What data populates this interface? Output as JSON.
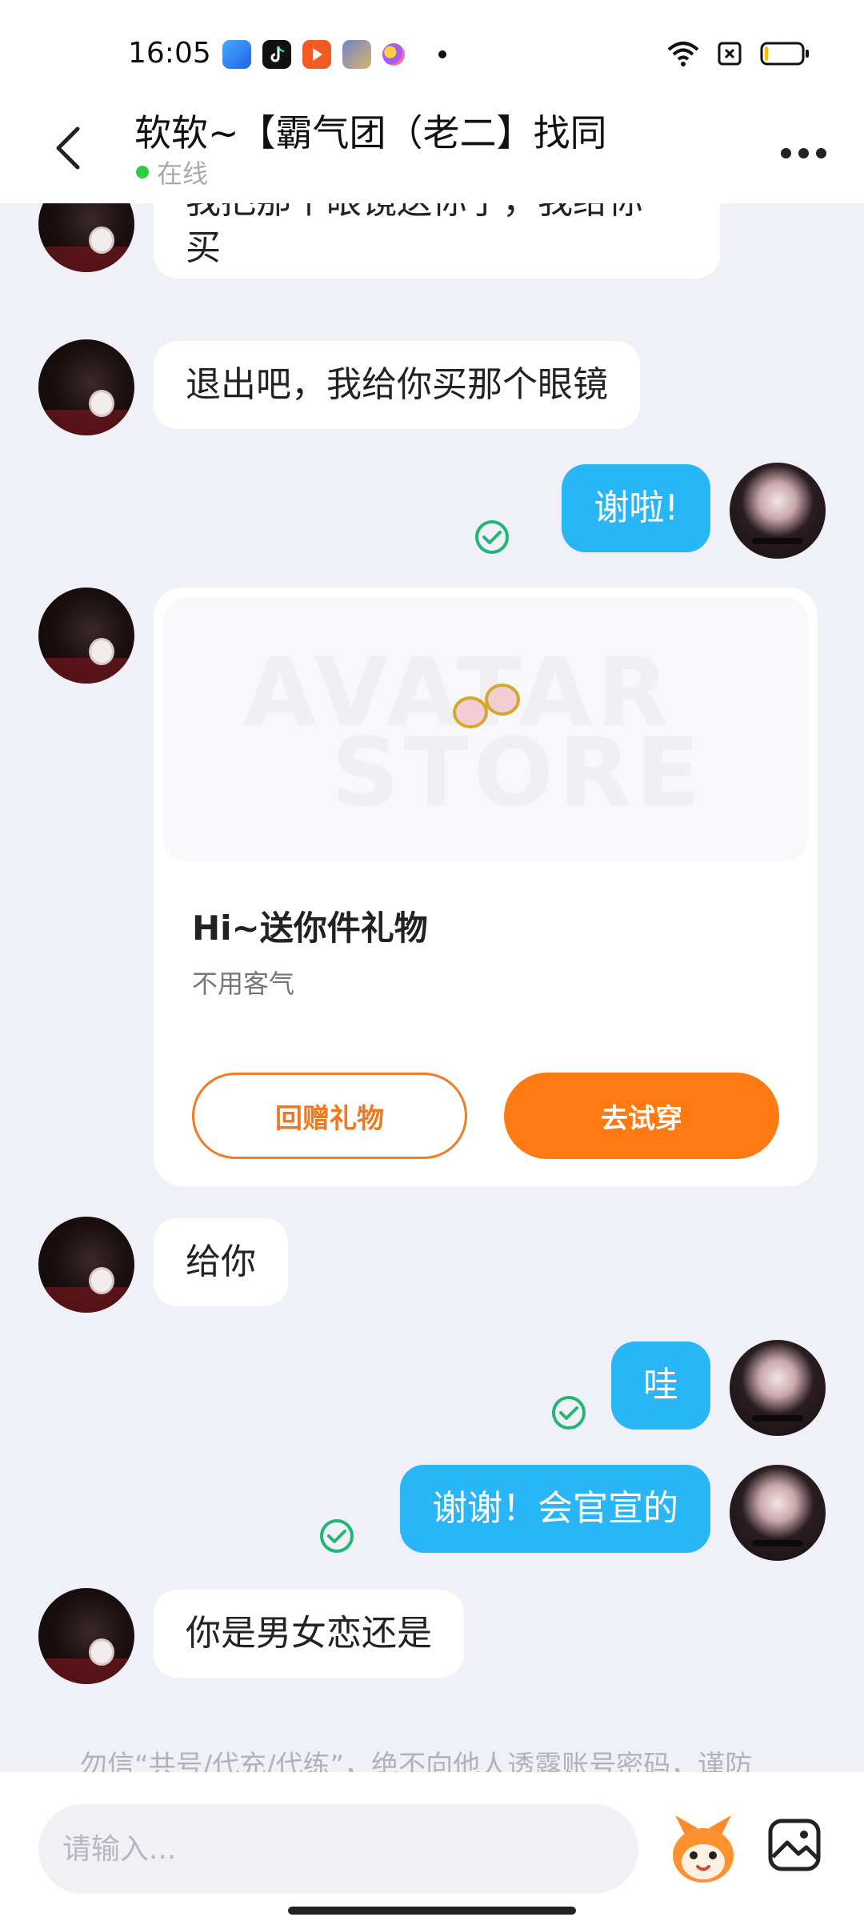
{
  "status_bar": {
    "time": "16:05",
    "battery_level": 0.1
  },
  "header": {
    "title": "软软~【霸气团（老二】找同",
    "status": "在线",
    "status_color": "#2ecc40"
  },
  "messages": [
    {
      "from": "them",
      "text_lines": [
        "我把那个眼镜送你了，我给你",
        "买"
      ]
    },
    {
      "from": "them",
      "text": "退出吧，我给你买那个眼镜"
    },
    {
      "from": "me",
      "text": "谢啦!",
      "read": true
    },
    {
      "from": "them",
      "type": "gift"
    },
    {
      "from": "them",
      "text": "给你"
    },
    {
      "from": "me",
      "text": "哇",
      "read": true
    },
    {
      "from": "me",
      "text": "谢谢！会官宣的",
      "read": true
    },
    {
      "from": "them",
      "text": "你是男女恋还是"
    }
  ],
  "gift_card": {
    "watermark_line1": "AVATAR",
    "watermark_line2": "STORE",
    "title": "Hi~送你件礼物",
    "subtitle": "不用客气",
    "return_button": "回赠礼物",
    "try_button": "去试穿"
  },
  "notice": "勿信“共号/代充/代练”，绝不向他人透露账号密码，谨防",
  "input": {
    "placeholder": "请输入..."
  },
  "colors": {
    "my_bubble": "#29b6f6",
    "accent_orange": "#ff7a12",
    "read_check": "#22b573"
  },
  "icons": [
    "back-arrow-icon",
    "more-dots-icon",
    "read-check-icon",
    "glasses-icon",
    "mascot-emoji-icon",
    "image-picker-icon"
  ]
}
